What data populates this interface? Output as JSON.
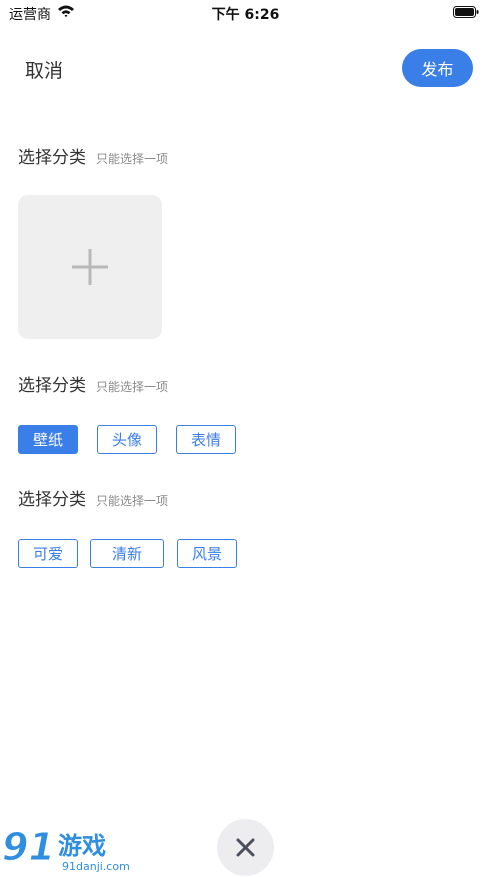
{
  "status_bar": {
    "carrier": "运营商",
    "time": "下午 6:26"
  },
  "nav": {
    "cancel_label": "取消",
    "publish_label": "发布"
  },
  "sections": [
    {
      "title": "选择分类",
      "hint": "只能选择一项"
    },
    {
      "title": "选择分类",
      "hint": "只能选择一项"
    },
    {
      "title": "选择分类",
      "hint": "只能选择一项"
    }
  ],
  "category_tags": [
    {
      "label": "壁纸",
      "selected": true
    },
    {
      "label": "头像",
      "selected": false
    },
    {
      "label": "表情",
      "selected": false
    }
  ],
  "style_tags": [
    {
      "label": "可爱",
      "selected": false
    },
    {
      "label": "清新",
      "selected": false
    },
    {
      "label": "风景",
      "selected": false
    }
  ],
  "watermark": {
    "number": "91",
    "brand": "游戏",
    "url": "91danji.com"
  },
  "colors": {
    "accent": "#3a7ee8",
    "upload_bg": "#efefef",
    "hint": "#8a8a8a"
  },
  "icons": {
    "upload": "plus-icon",
    "close": "close-icon"
  }
}
